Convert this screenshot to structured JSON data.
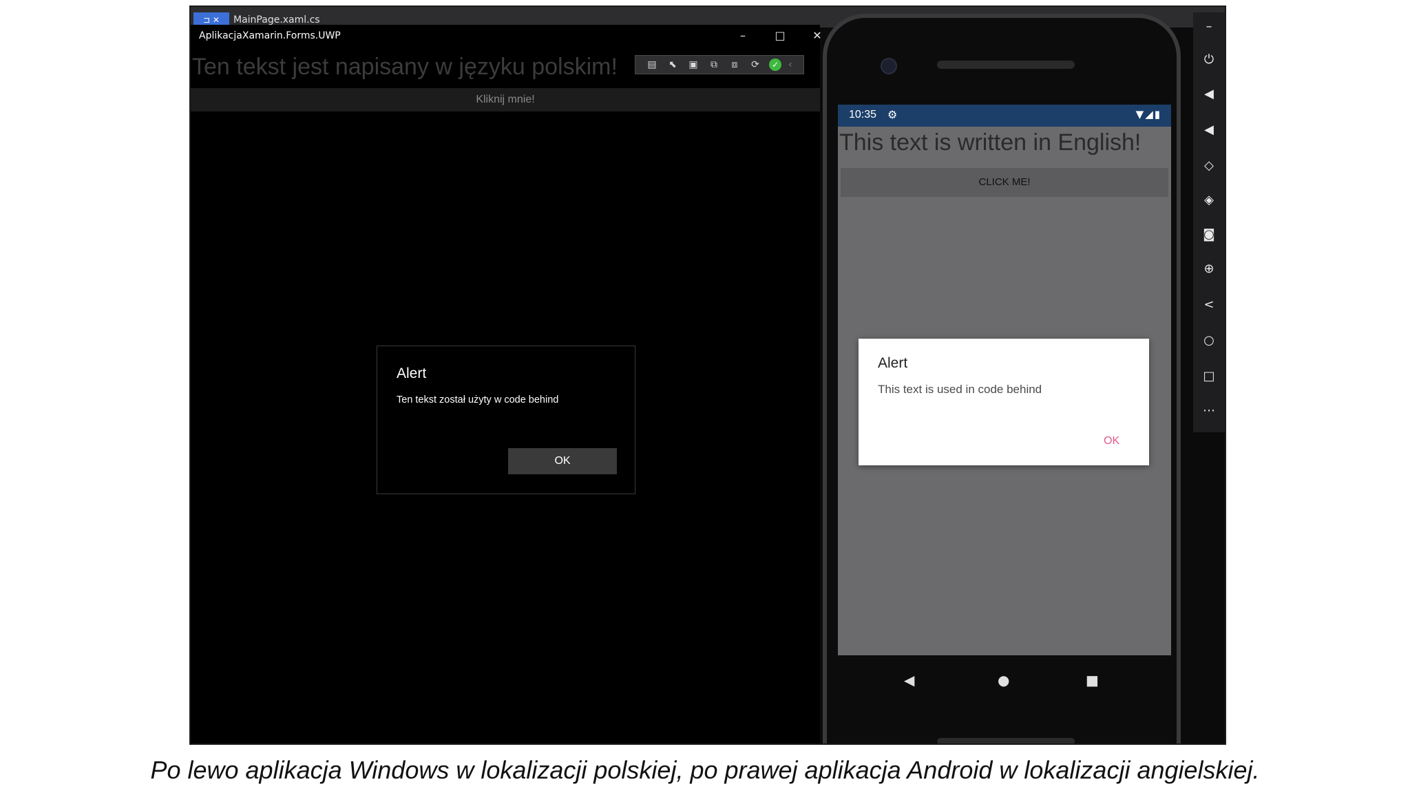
{
  "vs": {
    "tab_pin": "⊐ ✕",
    "tab_file": "MainPage.xaml.cs"
  },
  "uwp": {
    "window_title": "AplikacjaXamarin.Forms.UWP",
    "controls": {
      "minimize": "–",
      "maximize": "□",
      "close": "✕"
    },
    "heading": "Ten tekst jest napisany w języku polskim!",
    "button_label": "Kliknij mnie!",
    "dialog": {
      "title": "Alert",
      "message": "Ten tekst został użyty w code behind",
      "ok_label": "OK"
    },
    "debug_toolbar": [
      "live-visual-tree-icon",
      "select-element-icon",
      "display-adorners-icon",
      "track-focus-icon",
      "binding-failures-icon",
      "hot-reload-icon",
      "check-icon"
    ]
  },
  "android": {
    "status_time": "10:35",
    "heading": "This text is written in English!",
    "button_label": "CLICK ME!",
    "dialog": {
      "title": "Alert",
      "message": "This text is used in code behind",
      "ok_label": "OK",
      "ok_color": "#e05a8e"
    },
    "status_bar_color": "#1c3f69",
    "screen_color": "#6b6b6d"
  },
  "emulator_toolbar": [
    "minimize-icon",
    "power-icon",
    "volume-up-icon",
    "volume-down-icon",
    "rotate-left-icon",
    "rotate-right-icon",
    "camera-icon",
    "zoom-icon",
    "back-icon",
    "home-icon",
    "overview-icon",
    "more-icon"
  ],
  "caption": "Po lewo aplikacja Windows w lokalizacji polskiej, po prawej aplikacja Android w lokalizacji angielskiej."
}
